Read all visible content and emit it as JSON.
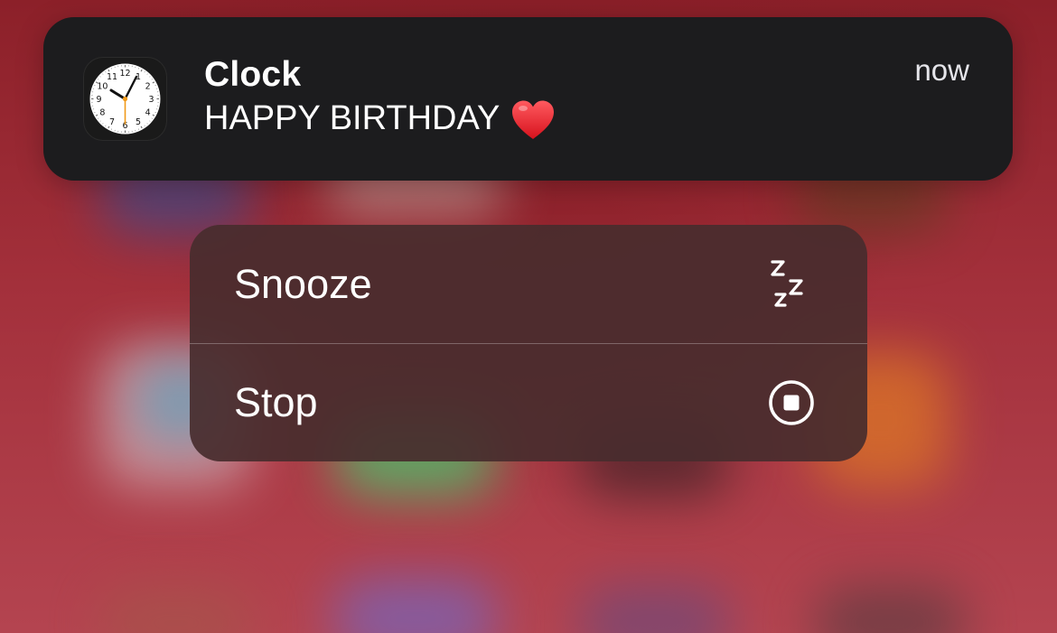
{
  "notification": {
    "app_name": "Clock",
    "message": "HAPPY BIRTHDAY",
    "emoji_icon": "heart-icon",
    "time": "now",
    "app_icon": "clock-app-icon",
    "clock_face_numbers": [
      "12",
      "1",
      "2",
      "3",
      "4",
      "5",
      "6",
      "7",
      "8",
      "9",
      "10",
      "11"
    ]
  },
  "actions": [
    {
      "label": "Snooze",
      "icon": "snooze-zzz-icon"
    },
    {
      "label": "Stop",
      "icon": "stop-circle-icon"
    }
  ],
  "colors": {
    "banner_background": "#1c1c1e",
    "menu_background": "#482d2e",
    "text": "#ffffff",
    "heart": "#e8222a",
    "clock_second_hand": "#f09a1a"
  }
}
